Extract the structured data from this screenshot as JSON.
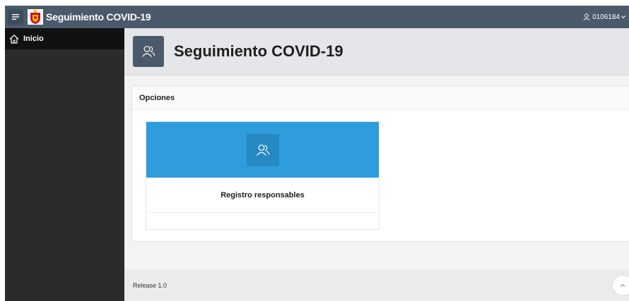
{
  "header": {
    "app_title": "Seguimiento COVID-19",
    "user_label": "0106184",
    "menu_icon": "hamburger-icon",
    "logo": "government-shield-logo",
    "bar_color": "#4a5a6b"
  },
  "sidebar": {
    "items": [
      {
        "label": "Inicio",
        "icon": "home-icon"
      }
    ]
  },
  "page": {
    "title": "Seguimiento COVID-19",
    "icon": "users-icon"
  },
  "region": {
    "title": "Opciones",
    "cards": [
      {
        "title": "Registro responsables",
        "icon": "users-icon",
        "color": "#2f9ddb"
      }
    ]
  },
  "footer": {
    "release": "Release 1.0"
  }
}
